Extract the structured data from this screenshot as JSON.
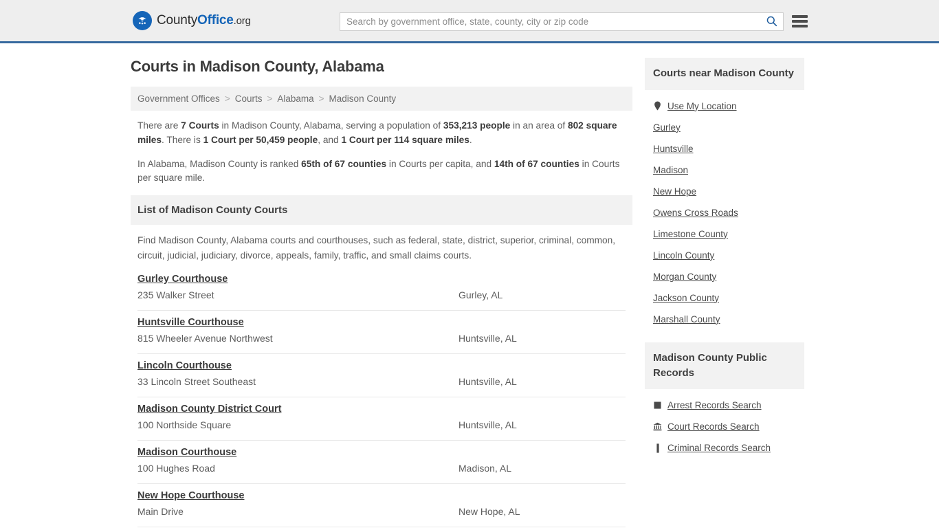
{
  "header": {
    "brand": {
      "part1": "County",
      "part2": "Office",
      "part3": ".org",
      "logo_icon": "eagle-logo-icon"
    },
    "search": {
      "placeholder": "Search by government office, state, county, city or zip code",
      "value": "",
      "icon": "search-icon"
    },
    "menu_icon": "hamburger-menu-icon",
    "accent_color": "#36699e",
    "brand_blue": "#1565b8"
  },
  "page_title": "Courts in Madison County, Alabama",
  "breadcrumb": [
    "Government Offices",
    "Courts",
    "Alabama",
    "Madison County"
  ],
  "breadcrumb_separator": ">",
  "stats": {
    "line1": {
      "t1": "There are ",
      "b1": "7 Courts",
      "t2": " in Madison County, Alabama, serving a population of ",
      "b2": "353,213 people",
      "t3": " in an area of ",
      "b3": "802 square miles",
      "t4": ". There is ",
      "b4": "1 Court per 50,459 people",
      "t5": ", and ",
      "b5": "1 Court per 114 square miles",
      "t6": "."
    },
    "line2": {
      "t1": "In Alabama, Madison County is ranked ",
      "b1": "65th of 67 counties",
      "t2": " in Courts per capita, and ",
      "b2": "14th of 67 counties",
      "t3": " in Courts per square mile."
    }
  },
  "list_section": {
    "heading": "List of Madison County Courts",
    "description": "Find Madison County, Alabama courts and courthouses, such as federal, state, district, superior, criminal, common, circuit, judicial, judiciary, divorce, appeals, family, traffic, and small claims courts."
  },
  "courts": [
    {
      "name": "Gurley Courthouse",
      "address": "235 Walker Street",
      "city": "Gurley, AL"
    },
    {
      "name": "Huntsville Courthouse",
      "address": "815 Wheeler Avenue Northwest",
      "city": "Huntsville, AL"
    },
    {
      "name": "Lincoln Courthouse",
      "address": "33 Lincoln Street Southeast",
      "city": "Huntsville, AL"
    },
    {
      "name": "Madison County District Court",
      "address": "100 Northside Square",
      "city": "Huntsville, AL"
    },
    {
      "name": "Madison Courthouse",
      "address": "100 Hughes Road",
      "city": "Madison, AL"
    },
    {
      "name": "New Hope Courthouse",
      "address": "Main Drive",
      "city": "New Hope, AL"
    }
  ],
  "sidebar": {
    "nearby": {
      "heading": "Courts near Madison County",
      "items": [
        {
          "label": "Use My Location",
          "icon": "map-pin-icon"
        },
        {
          "label": "Gurley",
          "icon": ""
        },
        {
          "label": "Huntsville",
          "icon": ""
        },
        {
          "label": "Madison",
          "icon": ""
        },
        {
          "label": "New Hope",
          "icon": ""
        },
        {
          "label": "Owens Cross Roads",
          "icon": ""
        },
        {
          "label": "Limestone County",
          "icon": ""
        },
        {
          "label": "Lincoln County",
          "icon": ""
        },
        {
          "label": "Morgan County",
          "icon": ""
        },
        {
          "label": "Jackson County",
          "icon": ""
        },
        {
          "label": "Marshall County",
          "icon": ""
        }
      ]
    },
    "records": {
      "heading": "Madison County Public Records",
      "items": [
        {
          "label": "Arrest Records Search",
          "icon": "square-badge-icon"
        },
        {
          "label": "Court Records Search",
          "icon": "courthouse-icon"
        },
        {
          "label": "Criminal Records Search",
          "icon": "bar-icon"
        }
      ]
    }
  }
}
